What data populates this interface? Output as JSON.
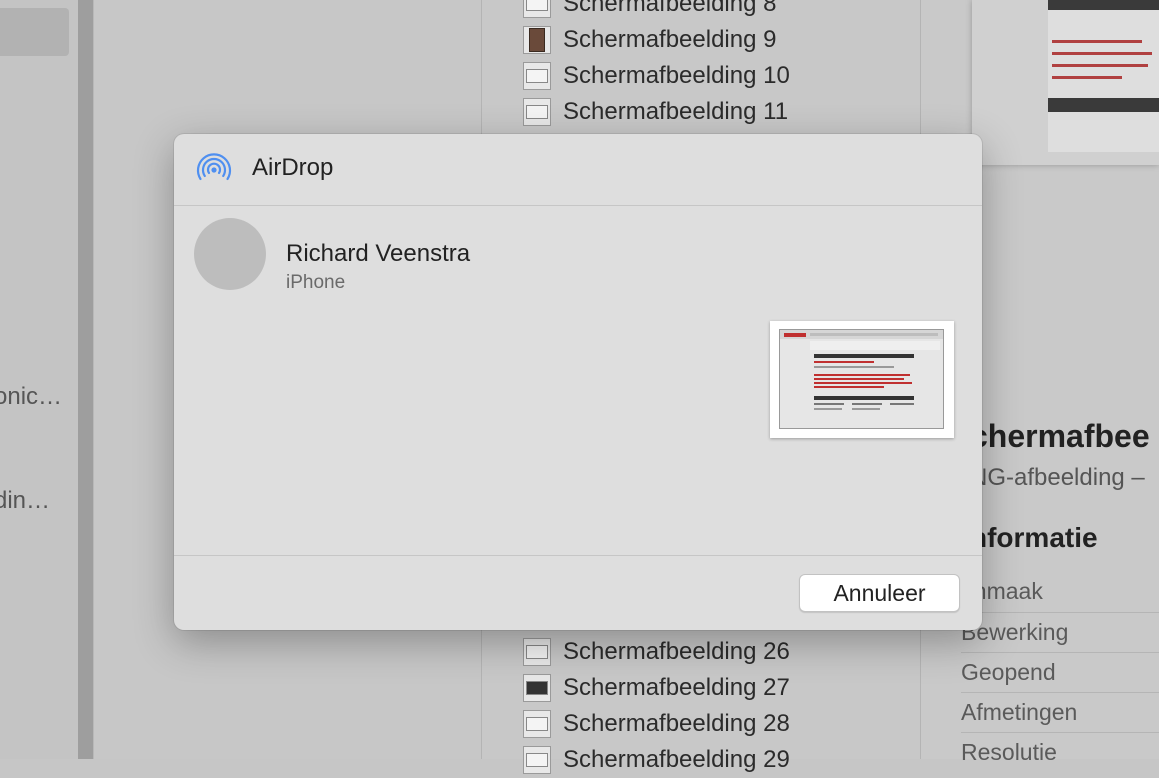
{
  "sidebar": {
    "partial_labels": [
      "onic…",
      "din…"
    ]
  },
  "file_list": {
    "top": [
      "Schermafbeelding 8",
      "Schermafbeelding 9",
      "Schermafbeelding 10",
      "Schermafbeelding 11"
    ],
    "bottom": [
      "Schermafbeelding 26",
      "Schermafbeelding 27",
      "Schermafbeelding 28",
      "Schermafbeelding 29"
    ]
  },
  "info_panel": {
    "title_partial": "chermafbee",
    "subtitle_partial": "NG-afbeelding –",
    "section_partial": "nformatie",
    "rows": [
      "anmaak",
      "Bewerking",
      "Geopend",
      "Afmetingen",
      "Resolutie"
    ]
  },
  "airdrop": {
    "title": "AirDrop",
    "icon": "airdrop-icon",
    "accent_color": "#4f8ff0",
    "recipient": {
      "name": "Richard Veenstra",
      "device": "iPhone"
    },
    "cancel_label": "Annuleer"
  }
}
